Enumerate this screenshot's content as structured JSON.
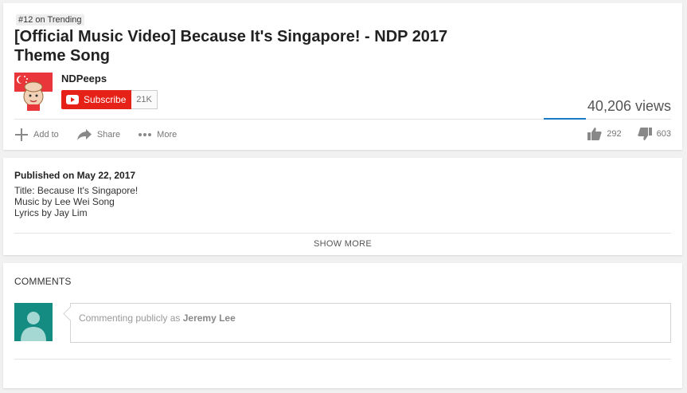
{
  "video": {
    "trending_badge": "#12 on Trending",
    "title": "[Official Music Video] Because It's Singapore! - NDP 2017 Theme Song",
    "views": "40,206 views"
  },
  "channel": {
    "name": "NDPeeps",
    "subscribe_label": "Subscribe",
    "subscriber_count": "21K"
  },
  "actions": {
    "add_to": "Add to",
    "share": "Share",
    "more": "More",
    "likes": "292",
    "dislikes": "603",
    "like_ratio": 0.33
  },
  "description": {
    "published": "Published on May 22, 2017",
    "lines": [
      "Title: Because It's Singapore!",
      "Music by Lee Wei Song",
      "Lyrics by Jay Lim"
    ],
    "show_more": "SHOW MORE"
  },
  "comments": {
    "header": "COMMENTS",
    "placeholder_prefix": "Commenting publicly as ",
    "user_name": "Jeremy Lee"
  },
  "colors": {
    "subscribe_red": "#e62117",
    "like_bar_blue": "#167ac6",
    "user_avatar_teal": "#148c82"
  }
}
